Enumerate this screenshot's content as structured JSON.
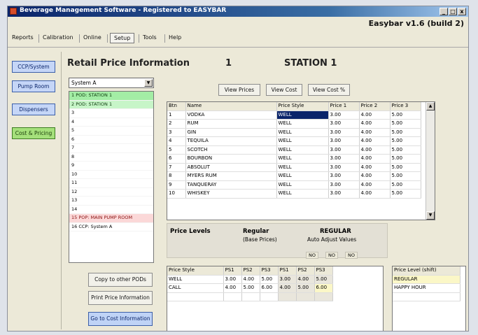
{
  "window": {
    "title": "Beverage Management Software - Registered to EASYBAR",
    "version": "Easybar v1.6 (build 2)"
  },
  "window_buttons": [
    "_",
    "□",
    "x"
  ],
  "menu": [
    "Reports",
    "Calibration",
    "Online",
    "Setup",
    "Tools",
    "Help"
  ],
  "active_menu": "Setup",
  "sidebar": [
    "CCP/System",
    "Pump Room",
    "Dispensers",
    "Cost & Pricing"
  ],
  "header": {
    "title": "Retail Price Information",
    "number": "1",
    "station": "STATION 1"
  },
  "system_select": {
    "value": "System A"
  },
  "pods": [
    "1 POD: STATION 1",
    "2 POD: STATION 1",
    "3",
    "4",
    "5",
    "6",
    "7",
    "8",
    "9",
    "10",
    "11",
    "12",
    "13",
    "14",
    "15 POP: MAIN PUMP ROOM",
    "16 CCP: System A"
  ],
  "actions": {
    "copy": "Copy to other PODs",
    "print": "Print Price Information",
    "goto_cost": "Go to Cost Information"
  },
  "view_buttons": {
    "prices": "View Prices",
    "cost": "View Cost",
    "cost_pct": "View Cost %"
  },
  "price_table": {
    "columns": [
      "Btn",
      "Name",
      "Price Style",
      "Price 1",
      "Price 2",
      "Price 3"
    ],
    "rows": [
      [
        "1",
        "VODKA",
        "WELL",
        "3.00",
        "4.00",
        "5.00"
      ],
      [
        "2",
        "RUM",
        "WELL",
        "3.00",
        "4.00",
        "5.00"
      ],
      [
        "3",
        "GIN",
        "WELL",
        "3.00",
        "4.00",
        "5.00"
      ],
      [
        "4",
        "TEQUILA",
        "WELL",
        "3.00",
        "4.00",
        "5.00"
      ],
      [
        "5",
        "SCOTCH",
        "WELL",
        "3.00",
        "4.00",
        "5.00"
      ],
      [
        "6",
        "BOURBON",
        "WELL",
        "3.00",
        "4.00",
        "5.00"
      ],
      [
        "7",
        "ABSOLUT",
        "WELL",
        "3.00",
        "4.00",
        "5.00"
      ],
      [
        "8",
        "MYERS RUM",
        "WELL",
        "3.00",
        "4.00",
        "5.00"
      ],
      [
        "9",
        "TANQUERAY",
        "WELL",
        "3.00",
        "4.00",
        "5.00"
      ],
      [
        "10",
        "WHISKEY",
        "WELL",
        "3.00",
        "4.00",
        "5.00"
      ]
    ]
  },
  "price_levels": {
    "label": "Price Levels",
    "regular_label": "Regular",
    "base_prices": "(Base Prices)",
    "level_name": "REGULAR",
    "auto_adjust_label": "Auto Adjust Values",
    "auto_adjust": [
      "NO",
      "NO",
      "NO"
    ]
  },
  "style_table": {
    "columns": [
      "Price Style",
      "PS1",
      "PS2",
      "PS3",
      "PS1",
      "PS2",
      "PS3"
    ],
    "rows": [
      [
        "WELL",
        "3.00",
        "4.00",
        "5.00",
        "3.00",
        "4.00",
        "5.00"
      ],
      [
        "CALL",
        "4.00",
        "5.00",
        "6.00",
        "4.00",
        "5.00",
        "6.00"
      ]
    ]
  },
  "level_table": {
    "header": "Price Level (shift)",
    "rows": [
      "REGULAR",
      "HAPPY HOUR"
    ]
  },
  "colors": {
    "sel_blue": "#0a246a",
    "pod_green": "#a3eda5",
    "pod_pink": "#fbd8d8",
    "side_blue": "#c5d6f7",
    "side_green": "#a5e07b"
  }
}
